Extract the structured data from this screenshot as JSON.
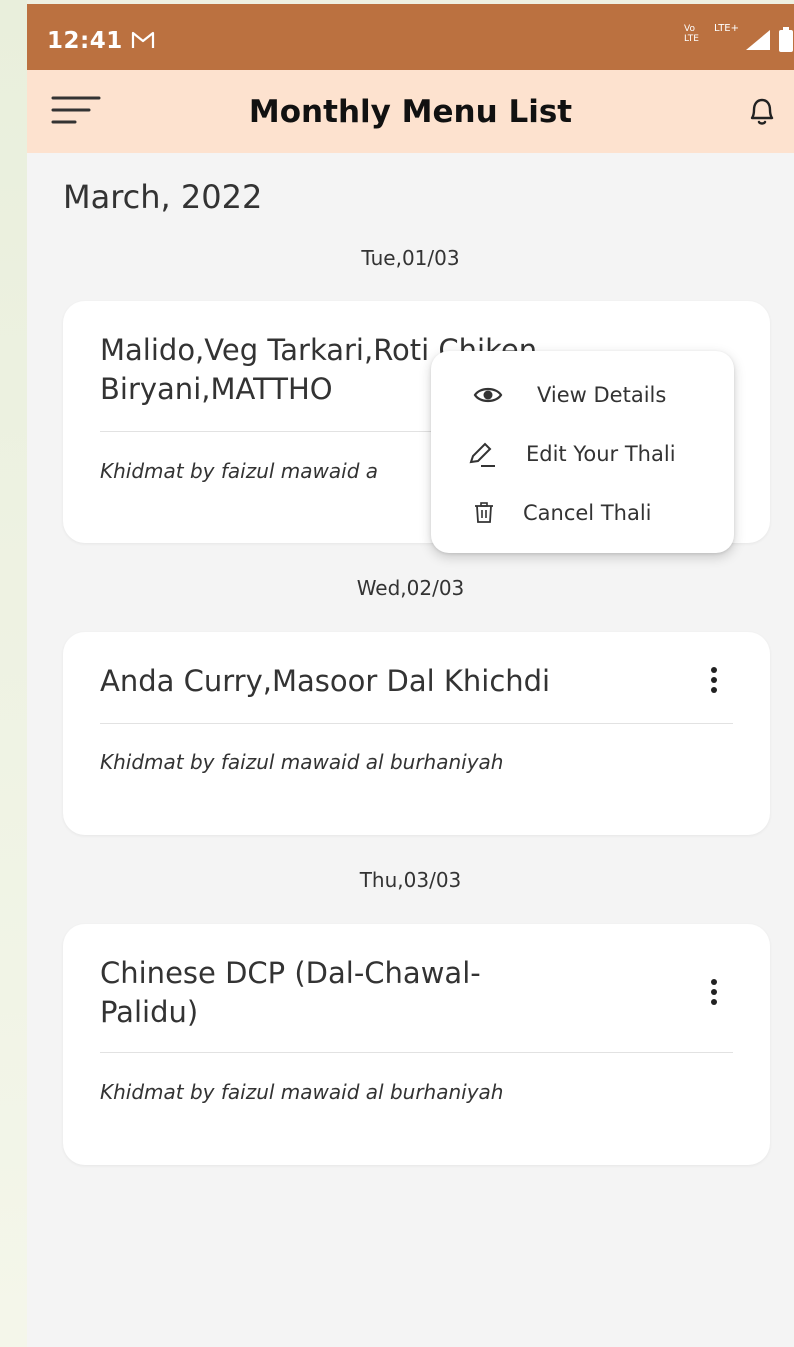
{
  "status_bar": {
    "time": "12:41",
    "mail_icon": "gmail-icon",
    "network_volte": "Vo LTE",
    "network_lte": "LTE+"
  },
  "app_bar": {
    "title": "Monthly Menu List",
    "menu_icon": "menu-icon",
    "bell_icon": "bell-icon"
  },
  "month_title": "March, 2022",
  "days": [
    {
      "date": "Tue,01/03",
      "title": "Malido,Veg Tarkari,Roti,Chiken Biryani,MATTHO",
      "title_line1": "Malido,Veg Tarkari,Roti Chiken",
      "title_line2": "Biryani,MATTHO",
      "subtitle": "Khidmat by faizul mawaid a"
    },
    {
      "date": "Wed,02/03",
      "title": "Anda Curry,Masoor Dal Khichdi",
      "subtitle": "Khidmat by faizul mawaid al burhaniyah"
    },
    {
      "date": "Thu,03/03",
      "title_line1": "Chinese DCP (Dal-Chawal-",
      "title_line2": "Palidu)",
      "subtitle": "Khidmat by faizul mawaid al burhaniyah"
    }
  ],
  "popup_menu": {
    "items": [
      {
        "label": "View Details",
        "icon": "eye-icon"
      },
      {
        "label": "Edit Your Thali",
        "icon": "pencil-icon"
      },
      {
        "label": "Cancel Thali",
        "icon": "trash-icon"
      }
    ]
  },
  "colors": {
    "status_bar": "#bb7140",
    "app_bar": "#fde2cf",
    "background": "#f4f4f4",
    "card": "#ffffff"
  }
}
